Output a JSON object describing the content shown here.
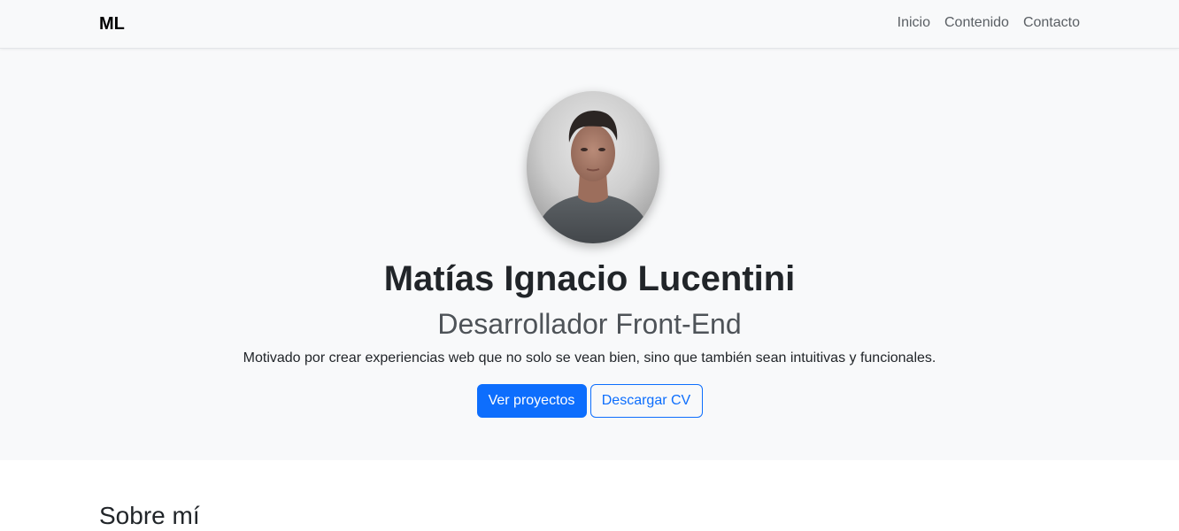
{
  "navbar": {
    "brand": "ML",
    "links": [
      "Inicio",
      "Contenido",
      "Contacto"
    ]
  },
  "hero": {
    "avatar_icon": "profile-photo",
    "name": "Matías Ignacio Lucentini",
    "role": "Desarrollador Front-End",
    "tagline": "Motivado por crear experiencias web que no solo se vean bien, sino que también sean intuitivas y funcionales.",
    "buttons": {
      "primary": "Ver proyectos",
      "secondary": "Descargar CV"
    }
  },
  "about": {
    "title": "Sobre mí"
  },
  "colors": {
    "accent": "#0d6efd",
    "navbar_bg": "#f8f9fa",
    "hero_bg": "#f8f9fa",
    "text": "#212529"
  }
}
